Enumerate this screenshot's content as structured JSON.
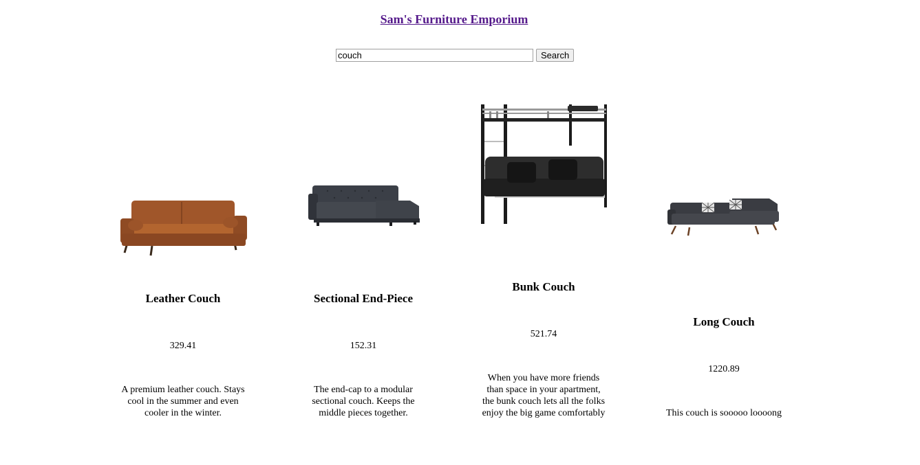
{
  "header": {
    "title": "Sam's Furniture Emporium"
  },
  "search": {
    "value": "couch",
    "button_label": "Search"
  },
  "products": [
    {
      "name": "Leather Couch",
      "price": "329.41",
      "description": "A premium leather couch. Stays cool in the summer and even cooler in the winter.",
      "image": "leather-couch-image"
    },
    {
      "name": "Sectional End-Piece",
      "price": "152.31",
      "description": "The end-cap to a modular sectional couch. Keeps the middle pieces together.",
      "image": "sectional-couch-image"
    },
    {
      "name": "Bunk Couch",
      "price": "521.74",
      "description": "When you have more friends than space in your apartment, the bunk couch lets all the folks enjoy the big game comfortably",
      "image": "bunk-couch-image"
    },
    {
      "name": "Long Couch",
      "price": "1220.89",
      "description": "This couch is sooooo loooong",
      "image": "long-couch-image"
    }
  ]
}
